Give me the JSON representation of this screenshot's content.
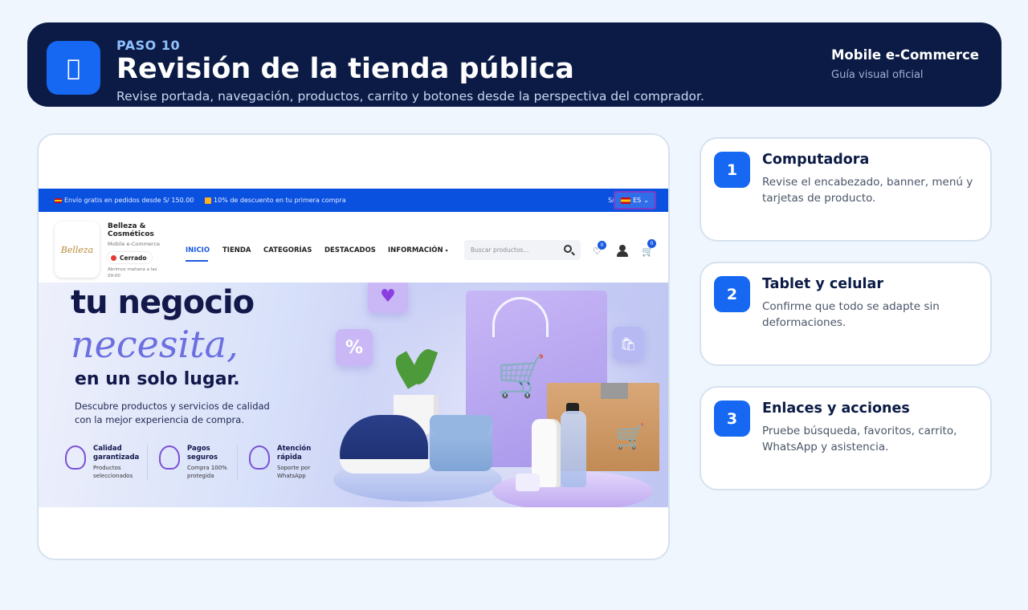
{
  "header": {
    "step": "PASO 10",
    "title": "Revisión de la tienda pública",
    "subtitle": "Revise portada, navegación, productos, carrito y botones desde la perspectiva del comprador.",
    "brand": "Mobile e-Commerce",
    "brand_sub": "Guía visual oficial",
    "icon": "store-icon"
  },
  "store": {
    "topbar": {
      "promo1": "Envío gratis en pedidos desde S/ 150.00",
      "promo2": "10% de descuento en tu primera compra",
      "currency": "S/",
      "language": "ES"
    },
    "logo_text": "Belleza",
    "name": "Belleza & Cosméticos",
    "tagline": "Mobile e-Commerce",
    "status": "Cerrado",
    "opens": "Abrimos mañana a las 09:00",
    "menu": [
      "INICIO",
      "TIENDA",
      "CATEGORÍAS",
      "DESTACADOS",
      "INFORMACIÓN"
    ],
    "search_placeholder": "Buscar productos...",
    "wishlist_count": "0",
    "cart_count": "0",
    "hero": {
      "line1": "tu negocio",
      "line2": "necesita,",
      "line3": "en un solo lugar.",
      "desc": "Descubre productos y servicios de calidad con la mejor experiencia de compra.",
      "features": [
        {
          "title": "Calidad garantizada",
          "desc": "Productos seleccionados"
        },
        {
          "title": "Pagos seguros",
          "desc": "Compra 100% protegida"
        },
        {
          "title": "Atención rápida",
          "desc": "Soporte por WhatsApp"
        }
      ]
    }
  },
  "cards": [
    {
      "number": "1",
      "title": "Computadora",
      "desc": "Revise el encabezado, banner, menú y tarjetas de producto."
    },
    {
      "number": "2",
      "title": "Tablet y celular",
      "desc": "Confirme que todo se adapte sin deformaciones."
    },
    {
      "number": "3",
      "title": "Enlaces y acciones",
      "desc": "Pruebe búsqueda, favoritos, carrito, WhatsApp y asistencia."
    }
  ],
  "colors": {
    "header_bg": "#0b1b45",
    "accent": "#1667f2",
    "page_bg": "#f0f6fd",
    "topbar_blue": "#0b51e0",
    "status_red": "#e53935"
  }
}
